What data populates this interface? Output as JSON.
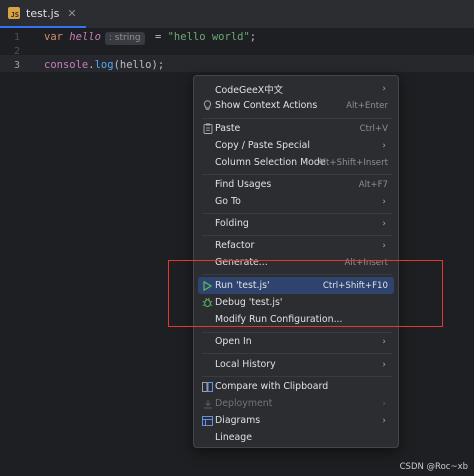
{
  "tab": {
    "label": "test.js",
    "badge": "JS"
  },
  "editor": {
    "line_numbers": [
      "1",
      "2",
      "3"
    ],
    "line1": {
      "keyword": "var",
      "name": "hello",
      "hint": ": string",
      "assign": " = ",
      "string": "\"hello world\"",
      "semicolon": ";"
    },
    "line3": {
      "object": "console",
      "dot": ".",
      "method": "log",
      "args": "(hello);"
    }
  },
  "menu": {
    "items": [
      {
        "label": "CodeGeeX中文",
        "shortcut": "",
        "submenu": true,
        "icon": ""
      },
      {
        "label": "Show Context Actions",
        "shortcut": "Alt+Enter",
        "submenu": false,
        "icon": "lightbulb-icon"
      },
      {
        "label": "Paste",
        "shortcut": "Ctrl+V",
        "submenu": false,
        "icon": "clipboard-icon"
      },
      {
        "label": "Copy / Paste Special",
        "shortcut": "",
        "submenu": true,
        "icon": ""
      },
      {
        "label": "Column Selection Mode",
        "shortcut": "Alt+Shift+Insert",
        "submenu": false,
        "icon": ""
      },
      {
        "label": "Find Usages",
        "shortcut": "Alt+F7",
        "submenu": false,
        "icon": ""
      },
      {
        "label": "Go To",
        "shortcut": "",
        "submenu": true,
        "icon": ""
      },
      {
        "label": "Folding",
        "shortcut": "",
        "submenu": true,
        "icon": ""
      },
      {
        "label": "Refactor",
        "shortcut": "",
        "submenu": true,
        "icon": ""
      },
      {
        "label": "Generate...",
        "shortcut": "Alt+Insert",
        "submenu": false,
        "icon": ""
      },
      {
        "label": "Run 'test.js'",
        "shortcut": "Ctrl+Shift+F10",
        "submenu": false,
        "icon": "run-icon"
      },
      {
        "label": "Debug 'test.js'",
        "shortcut": "",
        "submenu": false,
        "icon": "debug-icon"
      },
      {
        "label": "Modify Run Configuration...",
        "shortcut": "",
        "submenu": false,
        "icon": ""
      },
      {
        "label": "Open In",
        "shortcut": "",
        "submenu": true,
        "icon": ""
      },
      {
        "label": "Local History",
        "shortcut": "",
        "submenu": true,
        "icon": ""
      },
      {
        "label": "Compare with Clipboard",
        "shortcut": "",
        "submenu": false,
        "icon": "compare-icon"
      },
      {
        "label": "Deployment",
        "shortcut": "",
        "submenu": true,
        "icon": "deployment-icon",
        "disabled": true
      },
      {
        "label": "Diagrams",
        "shortcut": "",
        "submenu": true,
        "icon": "diagram-icon"
      },
      {
        "label": "Lineage",
        "shortcut": "",
        "submenu": false,
        "icon": ""
      }
    ]
  },
  "watermark": "CSDN @Roc~xb",
  "colors": {
    "accent": "#3574f0",
    "selection": "#2e436e",
    "annotation_box": "#e0392f",
    "run_green": "#5fb865"
  }
}
